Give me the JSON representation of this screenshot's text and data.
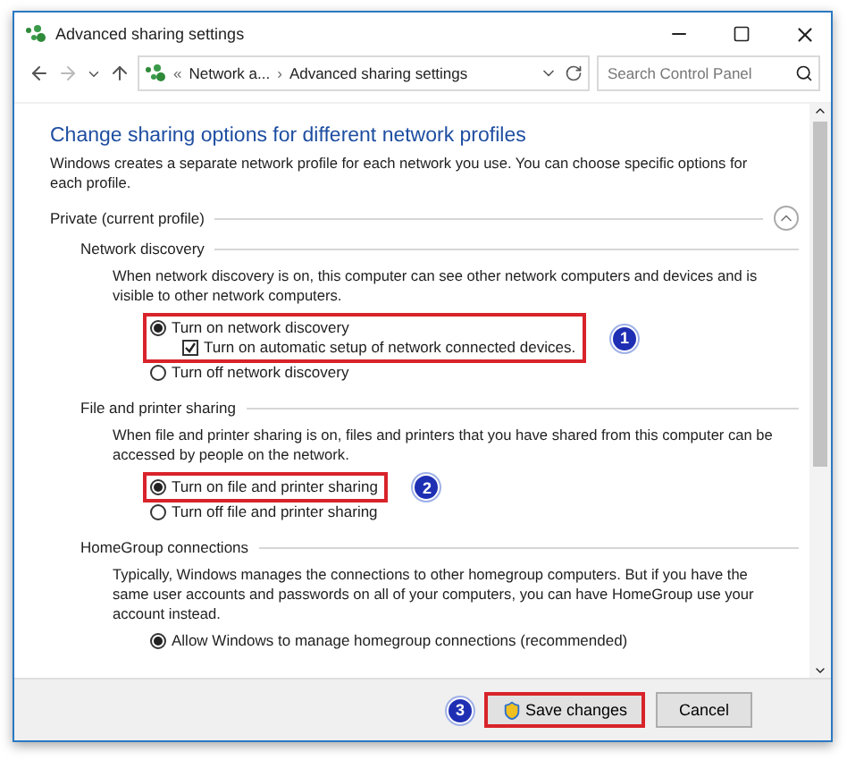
{
  "window": {
    "title": "Advanced sharing settings"
  },
  "address_bar": {
    "breadcrumb": [
      "«",
      "Network a...",
      "›",
      "Advanced sharing settings"
    ]
  },
  "search": {
    "placeholder": "Search Control Panel"
  },
  "heading": "Change sharing options for different network profiles",
  "description": "Windows creates a separate network profile for each network you use. You can choose specific options for each profile.",
  "profile": {
    "title": "Private (current profile)",
    "expanded": true,
    "groups": [
      {
        "title": "Network discovery",
        "description": "When network discovery is on, this computer can see other network computers and devices and is visible to other network computers.",
        "callout": "1",
        "options": [
          {
            "kind": "radio",
            "label": "Turn on network discovery",
            "selected": true,
            "highlighted": true
          },
          {
            "kind": "checkbox",
            "label": "Turn on automatic setup of network connected devices.",
            "checked": true,
            "highlighted": true
          },
          {
            "kind": "radio",
            "label": "Turn off network discovery",
            "selected": false,
            "highlighted": false
          }
        ]
      },
      {
        "title": "File and printer sharing",
        "description": "When file and printer sharing is on, files and printers that you have shared from this computer can be accessed by people on the network.",
        "callout": "2",
        "options": [
          {
            "kind": "radio",
            "label": "Turn on file and printer sharing",
            "selected": true,
            "highlighted": true
          },
          {
            "kind": "radio",
            "label": "Turn off file and printer sharing",
            "selected": false,
            "highlighted": false
          }
        ]
      },
      {
        "title": "HomeGroup connections",
        "description": "Typically, Windows manages the connections to other homegroup computers. But if you have the same user accounts and passwords on all of your computers, you can have HomeGroup use your account instead.",
        "options": [
          {
            "kind": "radio",
            "label": "Allow Windows to manage homegroup connections (recommended)",
            "selected": true,
            "highlighted": false
          }
        ]
      }
    ]
  },
  "footer": {
    "callout": "3",
    "buttons": [
      {
        "label": "Save changes",
        "highlighted": true,
        "shield": true
      },
      {
        "label": "Cancel",
        "highlighted": false,
        "shield": false
      }
    ]
  }
}
